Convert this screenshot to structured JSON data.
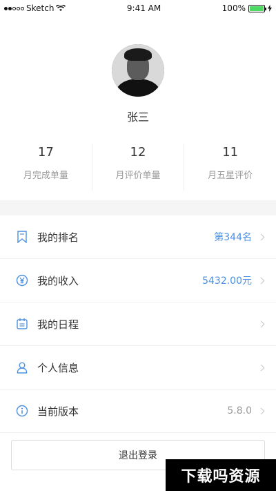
{
  "status_bar": {
    "carrier": "Sketch",
    "time": "9:41 AM",
    "battery": "100%"
  },
  "profile": {
    "name": "张三"
  },
  "stats": [
    {
      "value": "17",
      "label": "月完成单量"
    },
    {
      "value": "12",
      "label": "月评价单量"
    },
    {
      "value": "11",
      "label": "月五星评价"
    }
  ],
  "menu": [
    {
      "label": "我的排名",
      "value": "第344名",
      "icon": "bookmark-icon"
    },
    {
      "label": "我的收入",
      "value": "5432.00元",
      "icon": "yen-icon"
    },
    {
      "label": "我的日程",
      "value": "",
      "icon": "calendar-icon"
    },
    {
      "label": "个人信息",
      "value": "",
      "icon": "person-icon"
    },
    {
      "label": "当前版本",
      "value": "5.8.0",
      "icon": "info-icon"
    }
  ],
  "logout_label": "退出登录",
  "watermark": "下载吗资源",
  "colors": {
    "accent": "#4a90e2",
    "battery": "#4cd964"
  }
}
